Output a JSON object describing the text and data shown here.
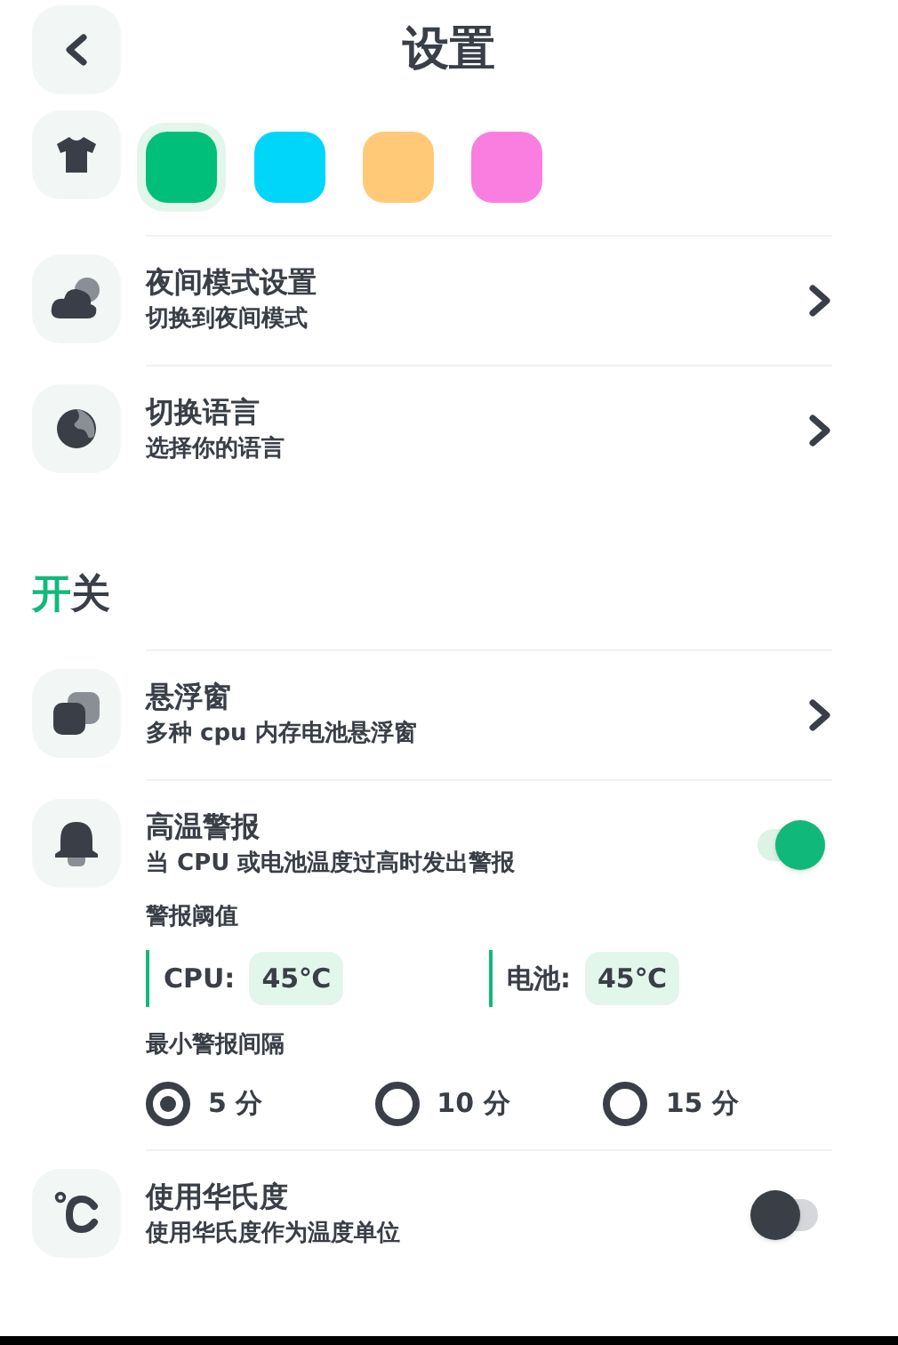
{
  "header": {
    "title": "设置"
  },
  "theme": {
    "swatches": [
      {
        "color": "#00bf7a",
        "selected": true
      },
      {
        "color": "#00d5fa",
        "selected": false
      },
      {
        "color": "#ffc978",
        "selected": false
      },
      {
        "color": "#f97ee0",
        "selected": false
      }
    ]
  },
  "display_rows": [
    {
      "kind": "link",
      "title": "夜间模式设置",
      "subtitle": "切换到夜间模式"
    },
    {
      "kind": "link",
      "title": "切换语言",
      "subtitle": "选择你的语言"
    }
  ],
  "switches_section": {
    "heading_accent": "开",
    "heading_rest": "关"
  },
  "switch_rows": [
    {
      "kind": "link",
      "title": "悬浮窗",
      "subtitle": "多种 cpu 内存电池悬浮窗"
    },
    {
      "kind": "toggle",
      "title": "高温警报",
      "subtitle": "当 CPU 或电池温度过高时发出警报",
      "on": true,
      "threshold_label": "警报阈值",
      "thresholds": [
        {
          "label": "CPU:",
          "value": "45℃"
        },
        {
          "label": "电池:",
          "value": "45℃"
        }
      ],
      "interval_label": "最小警报间隔",
      "intervals": [
        {
          "label": "5 分",
          "selected": true
        },
        {
          "label": "10 分",
          "selected": false
        },
        {
          "label": "15 分",
          "selected": false
        }
      ]
    },
    {
      "kind": "toggle",
      "title": "使用华氏度",
      "subtitle": "使用华氏度作为温度单位",
      "on": false
    }
  ]
}
